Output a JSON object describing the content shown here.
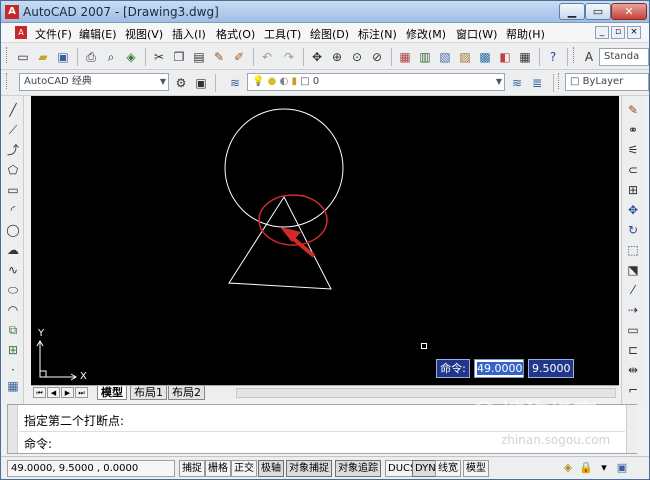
{
  "window": {
    "title": "AutoCAD 2007 - [Drawing3.dwg]",
    "app_icon": "A",
    "minimize": "▁",
    "maximize": "▭",
    "close": "✕"
  },
  "menu": {
    "items": [
      "文件(F)",
      "编辑(E)",
      "视图(V)",
      "插入(I)",
      "格式(O)",
      "工具(T)",
      "绘图(D)",
      "标注(N)",
      "修改(M)",
      "窗口(W)",
      "帮助(H)"
    ],
    "mdi_min": "_",
    "mdi_restore": "▫",
    "mdi_close": "×"
  },
  "toolbar1": {
    "style_combo": "Standa"
  },
  "toolbar2": {
    "workspace_combo": "AutoCAD 经典",
    "layer_combo": "0",
    "color_combo": "ByLayer"
  },
  "canvas": {
    "dyn_label": "命令:",
    "dyn_x": "49.0000",
    "dyn_y": "9.5000",
    "ucs_x": "X",
    "ucs_y": "Y"
  },
  "tabs": {
    "items": [
      "模型",
      "布局1",
      "布局2"
    ],
    "active": 0
  },
  "command": {
    "line1": "指定第二个打断点:",
    "line2": "命令:"
  },
  "status": {
    "coords": "49.0000, 9.5000 , 0.0000",
    "buttons": [
      "捕捉",
      "栅格",
      "正交",
      "极轴",
      "对象捕捉",
      "对象追踪",
      "DUCS",
      "DYN",
      "线宽",
      "模型"
    ]
  },
  "watermark": {
    "main": "搜狗指南",
    "sub": "zhinan.sogou.com"
  },
  "colors": {
    "canvas_bg": "#000000",
    "geometry": "#ffffff",
    "highlight": "#d22a2a"
  }
}
